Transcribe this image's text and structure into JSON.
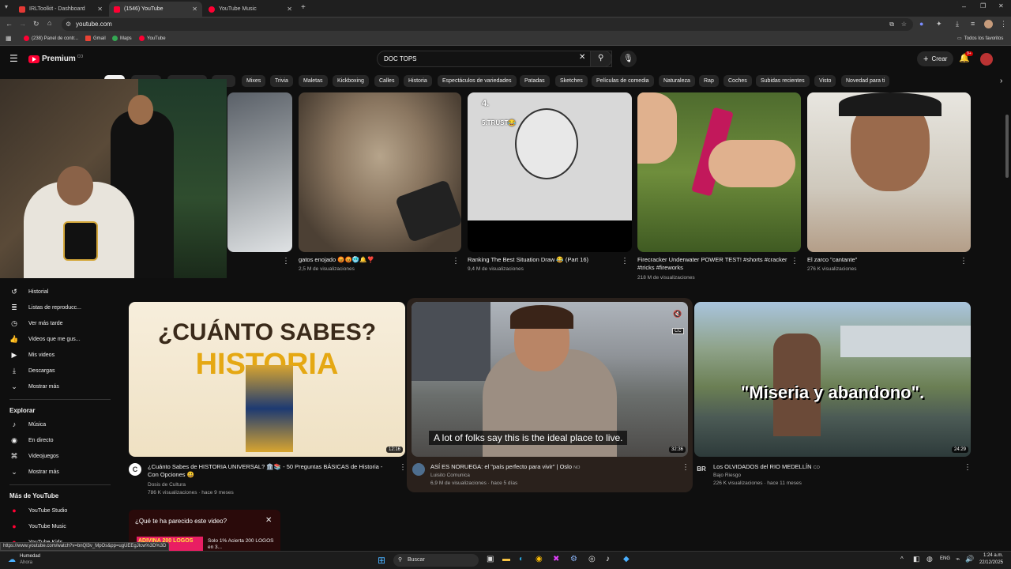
{
  "browser": {
    "tabs": [
      {
        "title": "IRLToolkit - Dashboard",
        "color": "#e53935"
      },
      {
        "title": "(1546) YouTube",
        "color": "#ff0033"
      },
      {
        "title": "YouTube Music",
        "color": "#ff0033"
      }
    ],
    "url": "youtube.com",
    "bookmarks": [
      "(238) Panel de contr...",
      "Gmail",
      "Maps",
      "YouTube"
    ],
    "all_bookmarks": "Todos los favoritos"
  },
  "header": {
    "logo": "Premium",
    "logo_badge": "CO",
    "search_value": "DOC TOPS",
    "create_label": "Crear",
    "notif_count": "9+"
  },
  "chips": [
    "Mixes",
    "Trivia",
    "Maletas",
    "Kickboxing",
    "Calles",
    "Historia",
    "Espectáculos de variedades",
    "Patadas",
    "Sketches",
    "Películas de comedia",
    "Naturaleza",
    "Rap",
    "Coches",
    "Subidas recientes",
    "Visto",
    "Novedad para ti"
  ],
  "sidebar": {
    "you_items": [
      {
        "label": "Historial",
        "icon": "history-icon"
      },
      {
        "label": "Listas de reproducc...",
        "icon": "playlist-icon"
      },
      {
        "label": "Ver más tarde",
        "icon": "clock-icon"
      },
      {
        "label": "Videos que me gus...",
        "icon": "like-icon"
      },
      {
        "label": "Mis videos",
        "icon": "video-icon"
      },
      {
        "label": "Descargas",
        "icon": "download-icon"
      },
      {
        "label": "Mostrar más",
        "icon": "chevron-down-icon"
      }
    ],
    "explore_title": "Explorar",
    "explore_items": [
      {
        "label": "Música",
        "icon": "music-icon"
      },
      {
        "label": "En directo",
        "icon": "live-icon"
      },
      {
        "label": "Videojuegos",
        "icon": "gamepad-icon"
      },
      {
        "label": "Mostrar más",
        "icon": "chevron-down-icon"
      }
    ],
    "more_title": "Más de YouTube",
    "more_items": [
      {
        "label": "YouTube Studio"
      },
      {
        "label": "YouTube Music"
      },
      {
        "label": "YouTube Kids"
      }
    ]
  },
  "shorts": [
    {
      "title": "gatos enojado 😡😡🥶🔔❣️",
      "views": "2,5 M de visualizaciones"
    },
    {
      "title": "Ranking The Best Situation Draw 😂 (Part 16)",
      "views": "9,4 M de visualizaciones",
      "overlay1": "4.",
      "overlay2": "5.TRUST😂"
    },
    {
      "title": "Firecracker Underwater POWER TEST! #shorts #cracker #tricks #fireworks",
      "views": "218 M de visualizaciones"
    },
    {
      "title": "El zarco \"cantante\"",
      "views": "276 K visualizaciones"
    }
  ],
  "videos": [
    {
      "title": "¿Cuánto Sabes de HISTORIA UNIVERSAL? 🏛️📚 - 50 Preguntas BÁSICAS de Historia - Con Opciones 😃",
      "channel": "Dosis de Cultura",
      "meta": "786 K visualizaciones · hace 9 meses",
      "duration": "12:16",
      "thumb_line1": "¿CUÁNTO SABES?",
      "thumb_line2": "HISTORIA"
    },
    {
      "title": "ASÍ ES NORUEGA: el \"país perfecto para vivir\" | Oslo",
      "title_badge": "NO",
      "channel": "Luisito Comunica",
      "meta": "6,9 M de visualizaciones · hace 5 días",
      "duration": "32:36",
      "caption": "A lot of folks say this is the ideal place to live."
    },
    {
      "title": "Los OLVIDADOS del RIO MEDELLÍN",
      "title_badge": "CO",
      "channel": "Bajo Riesgo",
      "meta": "226 K visualizaciones · hace 11 meses",
      "duration": "24:29",
      "thumb_text": "\"Miseria y abandono\".",
      "avatar_text": "BR"
    }
  ],
  "survey": {
    "question": "¿Qué te ha parecido este video?",
    "banner": "ADIVINA 200 LOGOS",
    "subtitle": "Solo 1% Acierta 200 LOGOS en 3..."
  },
  "status_url": "https://www.youtube.com/watch?v=bnQl3v_MpOs&pp=ugUEEgJlcw%3D%3D",
  "taskbar": {
    "weather": "Humedad",
    "weather_sub": "Ahora",
    "search": "Buscar",
    "lang": "ENG",
    "time": "1:24 a.m.",
    "date": "22/12/2025"
  }
}
